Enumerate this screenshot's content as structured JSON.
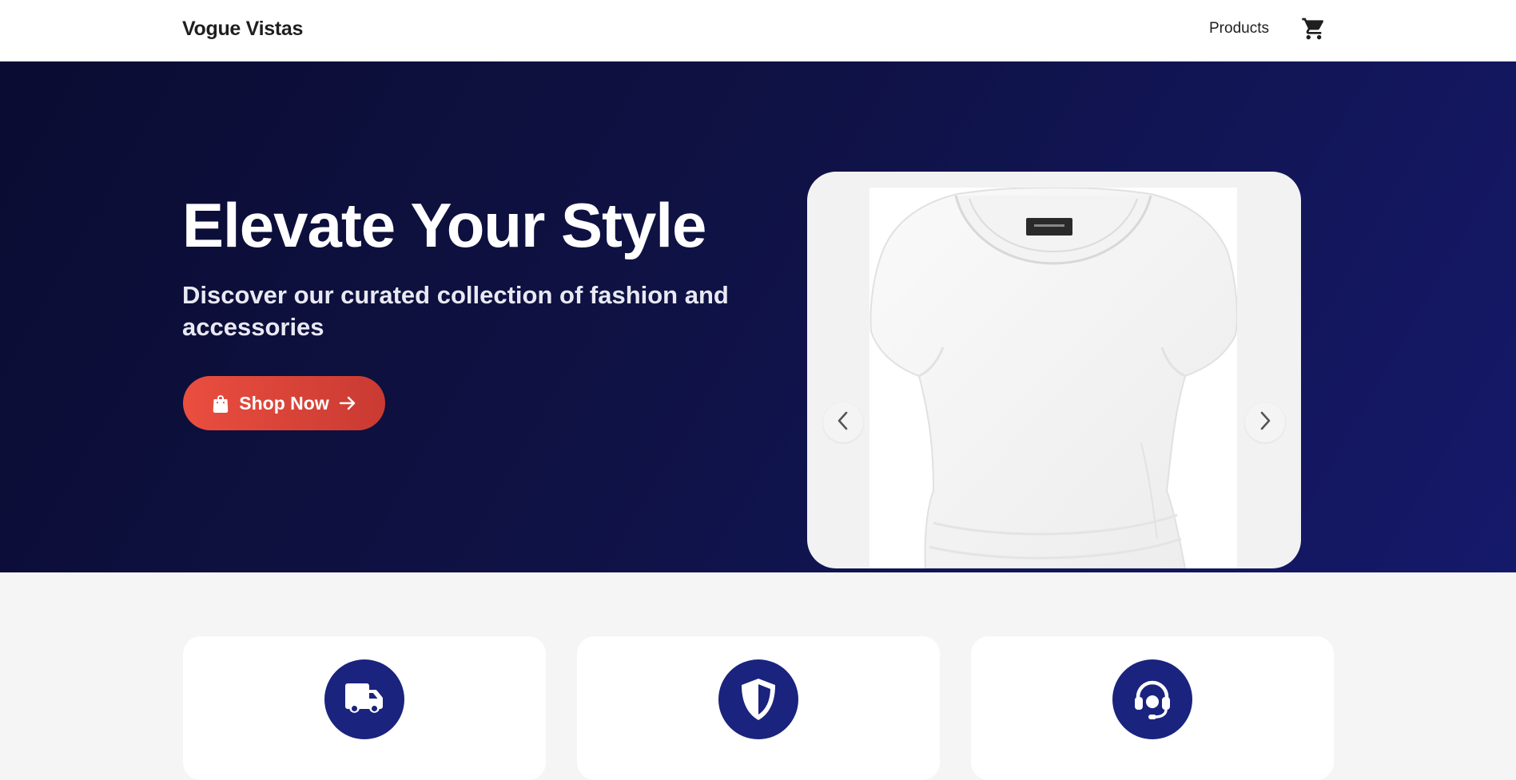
{
  "header": {
    "brand": "Vogue Vistas",
    "nav": {
      "products_label": "Products"
    },
    "cart_icon": "shopping-cart-icon"
  },
  "hero": {
    "title": "Elevate Your Style",
    "subtitle": "Discover our curated collection of fashion and accessories",
    "cta_label": "Shop Now",
    "cta_icons": [
      "shopping-bag-icon",
      "arrow-right-icon"
    ]
  },
  "carousel": {
    "image_alt": "White women's top",
    "prev_icon": "chevron-left-icon",
    "next_icon": "chevron-right-icon"
  },
  "features": [
    {
      "icon": "truck-icon"
    },
    {
      "icon": "shield-icon"
    },
    {
      "icon": "headset-icon"
    }
  ],
  "colors": {
    "hero_start": "#0b0c33",
    "hero_end": "#15196a",
    "accent": "#ea4e3f",
    "feature_icon_bg": "#1a237e",
    "page_bg": "#f5f5f5"
  }
}
